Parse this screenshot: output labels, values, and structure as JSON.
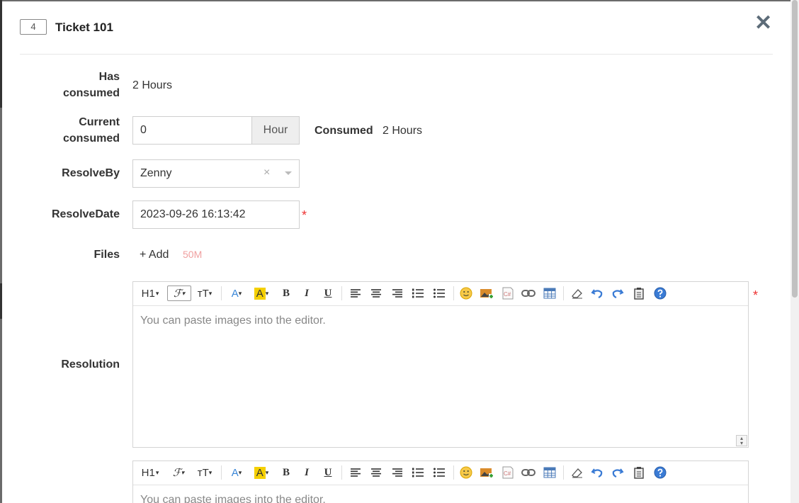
{
  "header": {
    "id_badge": "4",
    "title": "Ticket 101",
    "close_label": "✕"
  },
  "fields": {
    "has_consumed": {
      "label_line1": "Has",
      "label_line2": "consumed",
      "value": "2 Hours"
    },
    "current_consumed": {
      "label_line1": "Current",
      "label_line2": "consumed",
      "value": "0",
      "unit": "Hour",
      "consumed_label": "Consumed",
      "consumed_value": "2 Hours"
    },
    "resolve_by": {
      "label": "ResolveBy",
      "value": "Zenny",
      "clear": "×"
    },
    "resolve_date": {
      "label": "ResolveDate",
      "value": "2023-09-26 16:13:42",
      "required": "*"
    },
    "files": {
      "label": "Files",
      "add_label": "+ Add",
      "limit": "50M"
    },
    "resolution": {
      "label": "Resolution",
      "required": "*",
      "placeholder": "You can paste images into the editor."
    },
    "second_editor": {
      "placeholder": "You can paste images into the editor."
    }
  },
  "toolbar": {
    "heading": "H1",
    "font_family": "ℱ",
    "font_size": "ᴛT",
    "font_color": "A",
    "highlight": "A",
    "bold": "B",
    "italic": "I",
    "underline": "U",
    "code": "C#"
  },
  "colors": {
    "required": "#e33333",
    "accent_blue": "#3a87d8",
    "highlight_yellow": "#f5d000"
  }
}
